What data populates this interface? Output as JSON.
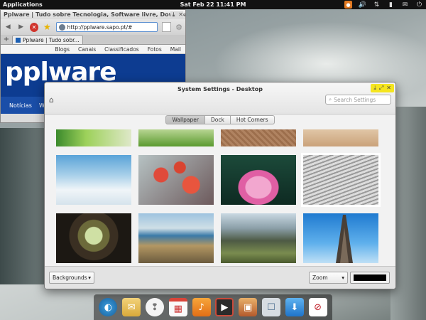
{
  "topbar": {
    "applications": "Applications",
    "clock": "Sat Feb 22 11:41 PM",
    "indicators": [
      "firefox-icon",
      "volume-icon",
      "network-icon",
      "battery-icon",
      "mail-icon",
      "power-icon"
    ]
  },
  "browser": {
    "window_title": "Pplware | Tudo sobre Tecnologia, Software livre, Download Sc",
    "url": "http://pplware.sapo.pt/#",
    "tab_label": "Pplware | Tudo sobr...",
    "links": [
      "Blogs",
      "Canais",
      "Classificados",
      "Fotos",
      "Mail"
    ],
    "site_logo": "pplware",
    "nav": [
      "Notícias",
      "Win"
    ]
  },
  "settings": {
    "title": "System Settings - Desktop",
    "search_placeholder": "Search Settings",
    "tabs": [
      {
        "label": "Wallpaper",
        "active": true
      },
      {
        "label": "Dock",
        "active": false
      },
      {
        "label": "Hot Corners",
        "active": false
      }
    ],
    "selected_wallpaper": "grey-stripes",
    "wallpapers": [
      "green-plant",
      "grass-flower",
      "sand-texture",
      "sand-beach",
      "clouds-sky",
      "red-maple-leaves",
      "pink-water-lily",
      "grey-stripes",
      "wooden-bridge-tunnel",
      "coast-fence",
      "mountain-valley",
      "eiffel-tower"
    ],
    "backgrounds_label": "Backgrounds",
    "zoom_label": "Zoom",
    "color": "#000000"
  },
  "dock": {
    "items": [
      "browser-icon",
      "mail-icon",
      "chat-icon",
      "calendar-icon",
      "music-icon",
      "video-icon",
      "photos-icon",
      "settings-icon",
      "download-icon",
      "search-zoom-icon"
    ]
  }
}
